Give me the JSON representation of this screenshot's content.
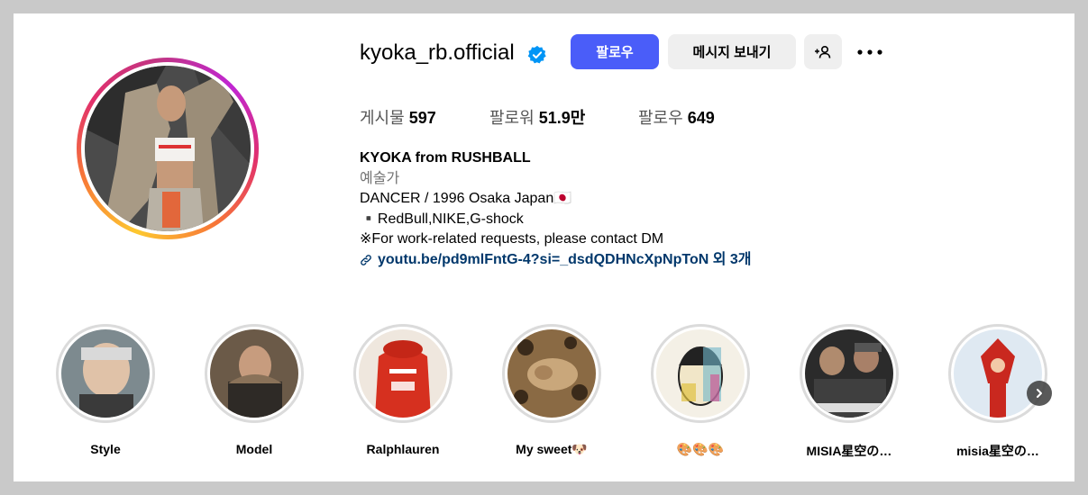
{
  "profile": {
    "username": "kyoka_rb.official",
    "verified_icon": "verified-badge-icon",
    "follow_label": "팔로우",
    "message_label": "메시지 보내기",
    "add_user_icon": "person-add-icon",
    "more_icon": "more-options-icon"
  },
  "stats": {
    "posts_label": "게시물",
    "posts_value": "597",
    "followers_label": "팔로워",
    "followers_value": "51.9만",
    "following_label": "팔로우",
    "following_value": "649"
  },
  "bio": {
    "name": "KYOKA from RUSHBALL",
    "category": "예술가",
    "line1": "DANCER / 1996 Osaka Japan🇯🇵",
    "line2": "▪️RedBull,NIKE,G-shock",
    "line3": "※For work-related requests, please contact DM",
    "link_text": "youtu.be/pd9mlFntG-4?si=_dsdQDHNcXpNpToN 외 3개",
    "link_icon": "link-icon"
  },
  "highlights": [
    {
      "label": "Style"
    },
    {
      "label": "Model"
    },
    {
      "label": "Ralphlauren"
    },
    {
      "label": "My sweet🐶"
    },
    {
      "label": "🎨🎨🎨"
    },
    {
      "label": "MISIA星空の…"
    },
    {
      "label": "misia星空の…"
    }
  ],
  "colors": {
    "follow_button": "#4a5df9",
    "link": "#00376b",
    "verified": "#0095f6"
  },
  "next_icon": "chevron-right-icon"
}
